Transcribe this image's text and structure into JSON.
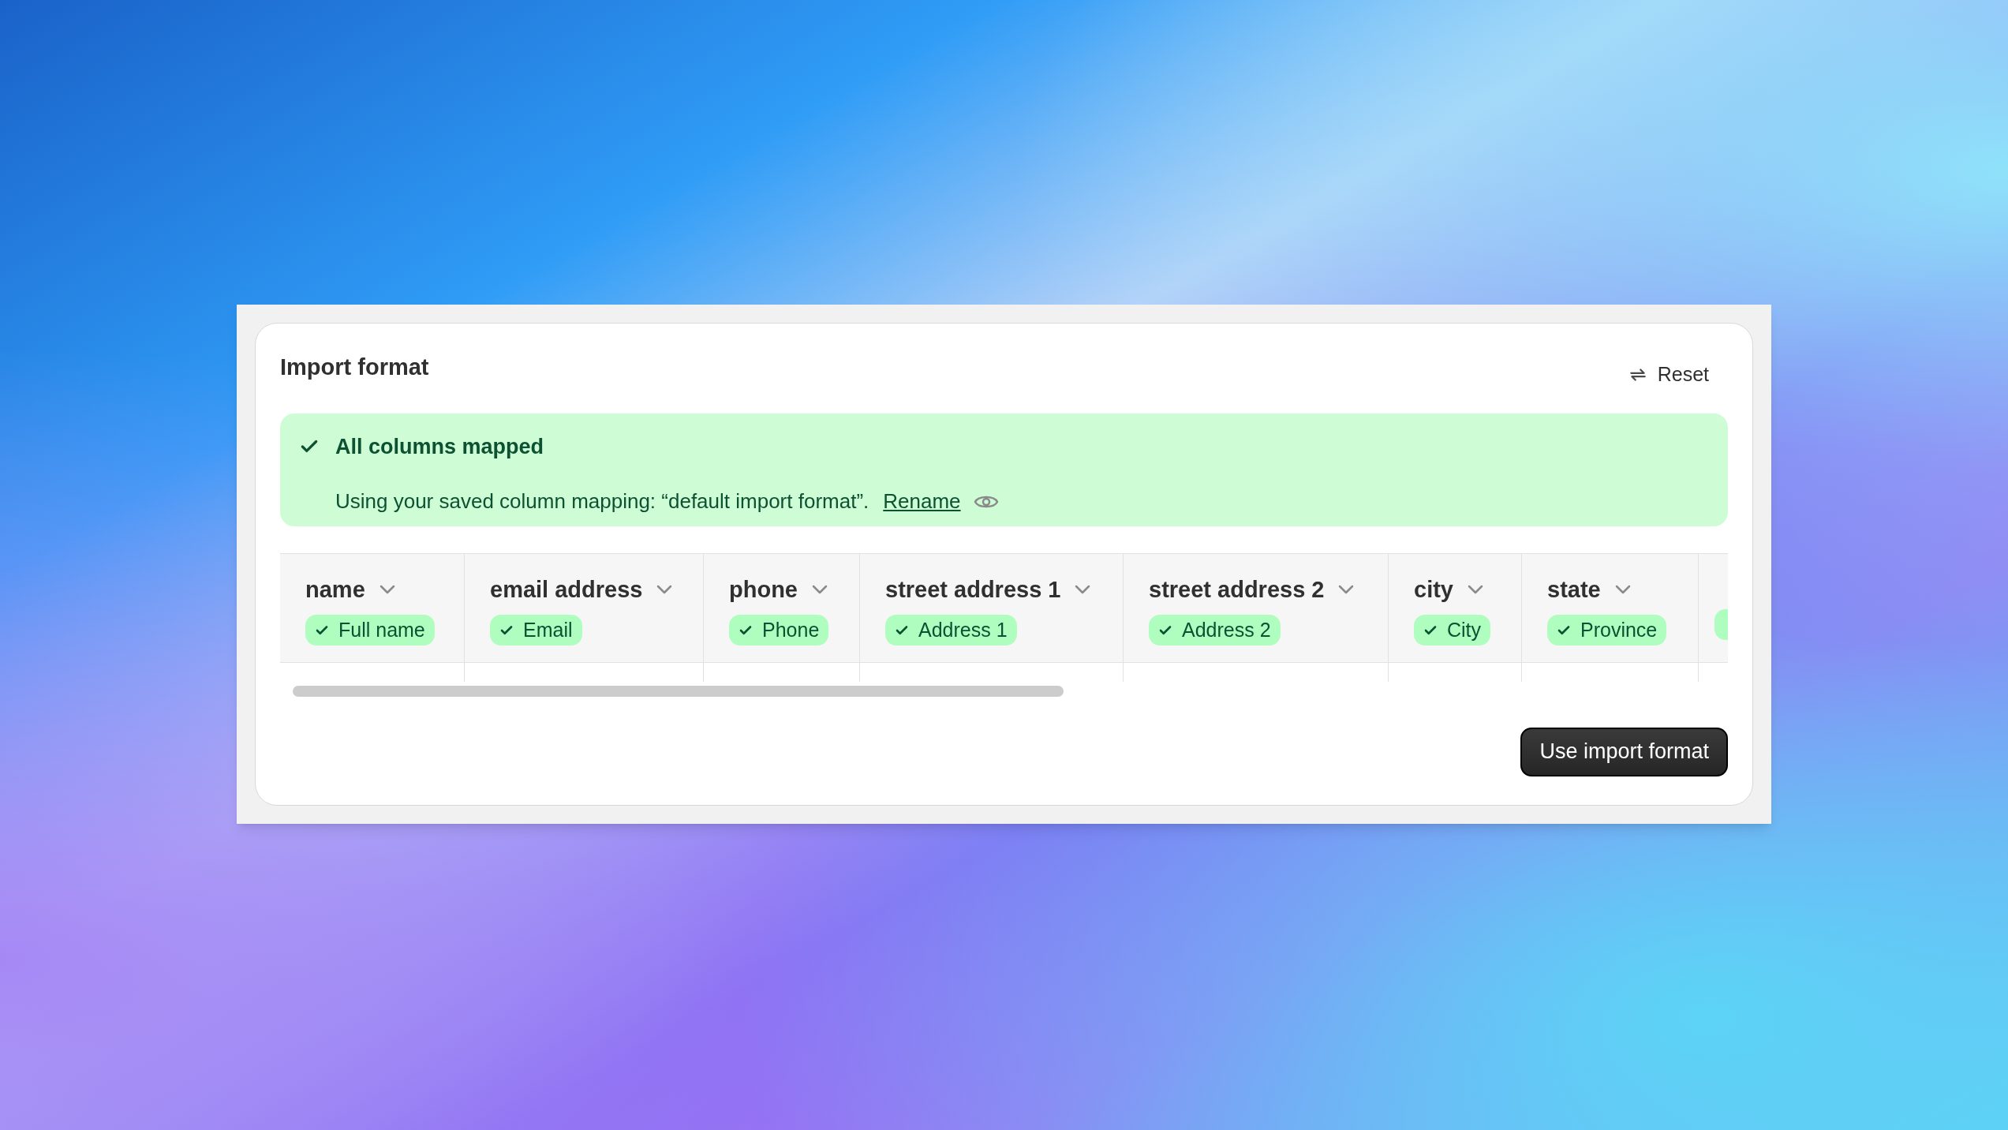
{
  "panel": {
    "title": "Import format",
    "reset_button": "Reset"
  },
  "banner": {
    "title": "All columns mapped",
    "message": "Using your saved column mapping: “default import format”.",
    "link": "Rename"
  },
  "columns": [
    {
      "header": "name",
      "mapped_to": "Full name",
      "mapped": true
    },
    {
      "header": "email address",
      "mapped_to": "Email",
      "mapped": true
    },
    {
      "header": "phone",
      "mapped_to": "Phone",
      "mapped": true
    },
    {
      "header": "street address 1",
      "mapped_to": "Address 1",
      "mapped": true
    },
    {
      "header": "street address 2",
      "mapped_to": "Address 2",
      "mapped": true
    },
    {
      "header": "city",
      "mapped_to": "City",
      "mapped": true
    },
    {
      "header": "state",
      "mapped_to": "Province",
      "mapped": true
    }
  ],
  "primary_button": "Use import format"
}
